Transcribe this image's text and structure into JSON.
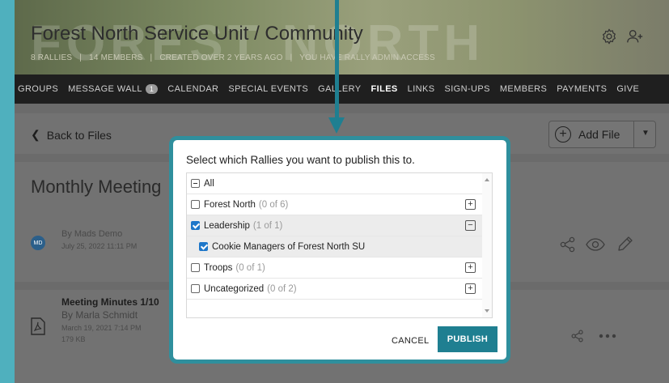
{
  "header": {
    "title": "Forest North Service Unit / Community",
    "watermark": "FOREST NORTH",
    "meta": [
      "8 RALLIES",
      "|",
      "14 MEMBERS",
      "|",
      "CREATED OVER 2 YEARS AGO",
      "|",
      "YOU HAVE RALLY ADMIN ACCESS"
    ]
  },
  "nav": {
    "items": [
      "GROUPS",
      "MESSAGE WALL",
      "CALENDAR",
      "SPECIAL EVENTS",
      "GALLERY",
      "FILES",
      "LINKS",
      "SIGN-UPS",
      "MEMBERS",
      "PAYMENTS",
      "GIVE"
    ],
    "message_wall_badge": "1",
    "active": "FILES"
  },
  "toolbar": {
    "back_label": "Back to Files",
    "add_file_label": "Add File"
  },
  "post": {
    "title": "Monthly Meeting",
    "avatar_initials": "MD",
    "author": "By Mads Demo",
    "date": "July 25, 2022 11:11 PM"
  },
  "file": {
    "title": "Meeting Minutes 1/10",
    "author": "By Marla Schmidt",
    "date": "March 19, 2021 7:14 PM",
    "size": "179 KB"
  },
  "modal": {
    "title": "Select which Rallies you want to publish this to.",
    "rows": [
      {
        "label": "All",
        "count": "",
        "checked": false,
        "toggle": ""
      },
      {
        "label": "Forest North",
        "count": "(0 of 6)",
        "checked": false,
        "toggle": "+"
      },
      {
        "label": "Leadership",
        "count": "(1 of 1)",
        "checked": true,
        "toggle": "−"
      },
      {
        "label": "Cookie Managers of Forest North SU",
        "count": "",
        "checked": true,
        "toggle": ""
      },
      {
        "label": "Troops",
        "count": "(0 of 1)",
        "checked": false,
        "toggle": "+"
      },
      {
        "label": "Uncategorized",
        "count": "(0 of 2)",
        "checked": false,
        "toggle": "+"
      }
    ],
    "cancel_label": "CANCEL",
    "publish_label": "PUBLISH"
  },
  "colors": {
    "accent": "#1f7f91",
    "modal_border": "#2f8f9d",
    "checkbox": "#1e77c9",
    "outer_background": "#4fb0be"
  }
}
